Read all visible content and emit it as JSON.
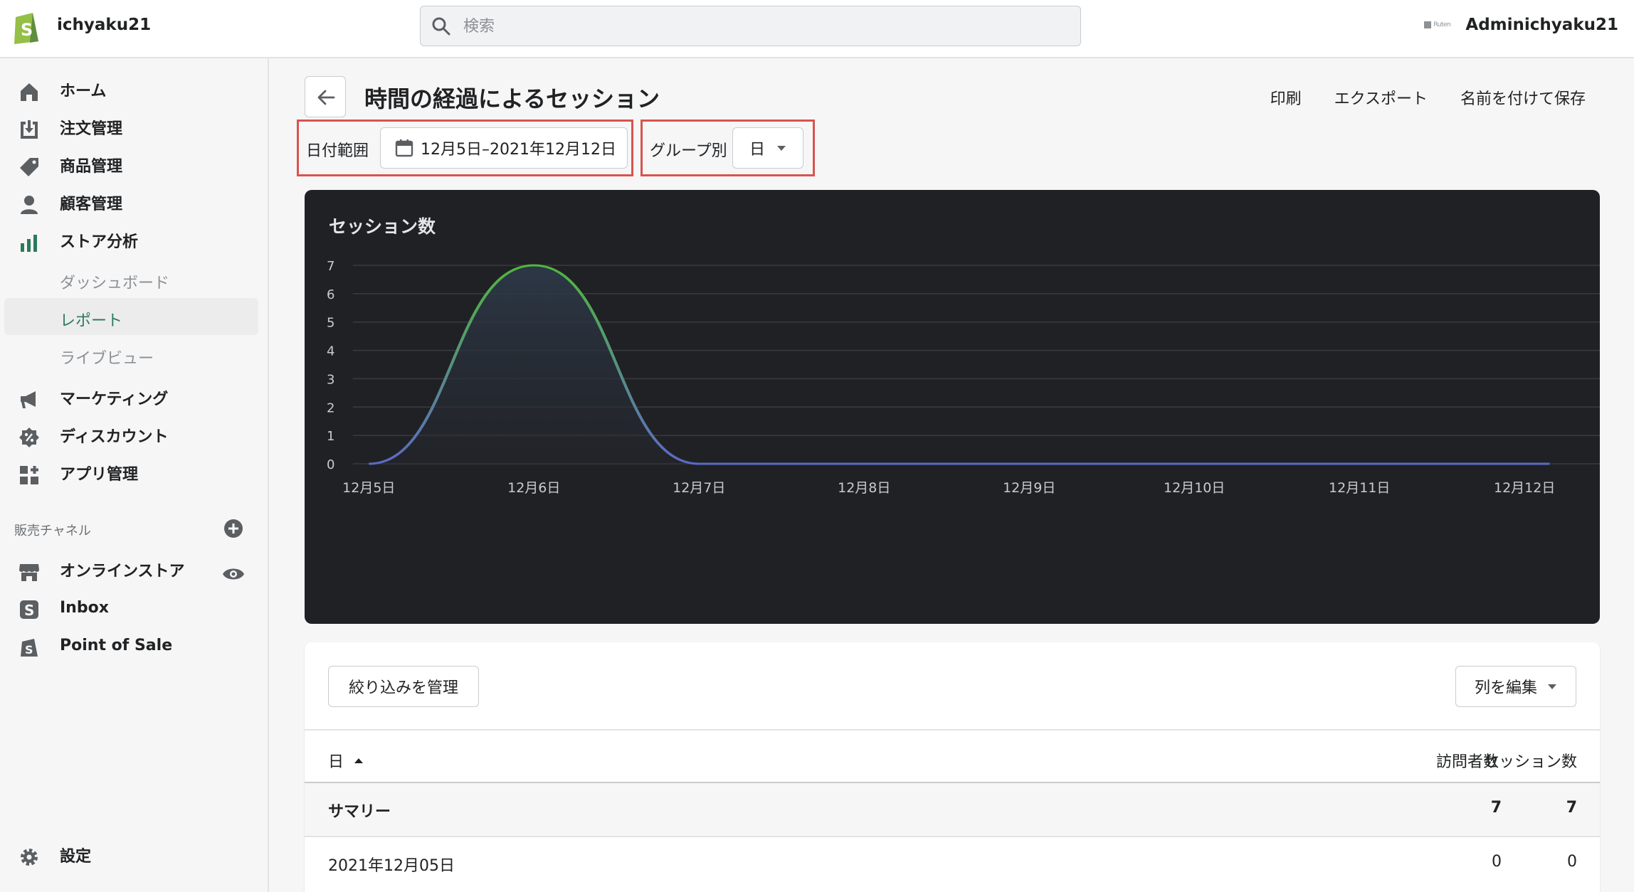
{
  "topbar": {
    "store_name": "ichyaku21",
    "search_placeholder": "検索",
    "account_name": "Adminichyaku21",
    "avatar_text": "Ruten"
  },
  "sidebar": {
    "items": [
      {
        "label": "ホーム",
        "icon": "home-icon"
      },
      {
        "label": "注文管理",
        "icon": "orders-icon"
      },
      {
        "label": "商品管理",
        "icon": "tag-icon"
      },
      {
        "label": "顧客管理",
        "icon": "customer-icon"
      },
      {
        "label": "ストア分析",
        "icon": "analytics-icon"
      }
    ],
    "analytics_sub": [
      {
        "label": "ダッシュボード",
        "active": false
      },
      {
        "label": "レポート",
        "active": true
      },
      {
        "label": "ライブビュー",
        "active": false
      }
    ],
    "items2": [
      {
        "label": "マーケティング",
        "icon": "megaphone-icon"
      },
      {
        "label": "ディスカウント",
        "icon": "discount-icon"
      },
      {
        "label": "アプリ管理",
        "icon": "apps-icon"
      }
    ],
    "channels_heading": "販売チャネル",
    "channels": [
      {
        "label": "オンラインストア",
        "icon": "store-icon"
      },
      {
        "label": "Inbox",
        "icon": "inbox-icon"
      },
      {
        "label": "Point of Sale",
        "icon": "pos-icon"
      }
    ],
    "settings_label": "設定"
  },
  "page": {
    "title": "時間の経過によるセッション",
    "actions": [
      "印刷",
      "エクスポート",
      "名前を付けて保存"
    ],
    "date_range_label": "日付範囲",
    "date_range_value": "12月5日–2021年12月12日",
    "group_by_label": "グループ別",
    "group_by_value": "日"
  },
  "chart_data": {
    "type": "line",
    "title": "セッション数",
    "categories": [
      "12月5日",
      "12月6日",
      "12月7日",
      "12月8日",
      "12月9日",
      "12月10日",
      "12月11日",
      "12月12日"
    ],
    "series": [
      {
        "values": [
          0,
          7,
          0,
          0,
          0,
          0,
          0,
          0
        ]
      }
    ],
    "ylim": [
      0,
      7
    ],
    "yticks": [
      0,
      1,
      2,
      3,
      4,
      5,
      6,
      7
    ],
    "grid": true,
    "colors": {
      "line_start": "#5c6ac4",
      "line_peak": "#50b83c",
      "background": "#202124",
      "grid": "#3a3b3e"
    }
  },
  "table": {
    "manage_filters": "絞り込みを管理",
    "edit_columns": "列を編集",
    "headers": {
      "day": "日",
      "visitors": "訪問者数",
      "sessions": "セッション数"
    },
    "summary": {
      "label": "サマリー",
      "visitors": "7",
      "sessions": "7"
    },
    "rows": [
      {
        "day": "2021年12月05日",
        "visitors": "0",
        "sessions": "0"
      }
    ]
  }
}
